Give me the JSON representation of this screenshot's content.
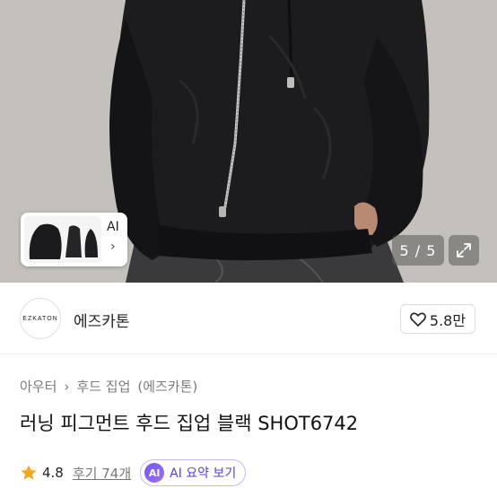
{
  "gallery": {
    "counter": "5 / 5",
    "thumb_strip_label": "AI",
    "thumb_strip_chevron": "›"
  },
  "store": {
    "logo_text": "EZKATON",
    "name": "에즈카톤",
    "like_count": "5.8만"
  },
  "breadcrumb": {
    "items": [
      "아우터",
      "후드 집업",
      "(에즈카톤)"
    ],
    "separator": "›"
  },
  "product": {
    "title": "러닝 피그먼트 후드 집업 블랙 SHOT6742"
  },
  "rating": {
    "score": "4.8",
    "reviews_label": "후기 74개",
    "star_color": "#f5a623"
  },
  "ai_summary": {
    "badge": "AI",
    "label": "AI 요약 보기",
    "accent": "#6b5cf0"
  }
}
